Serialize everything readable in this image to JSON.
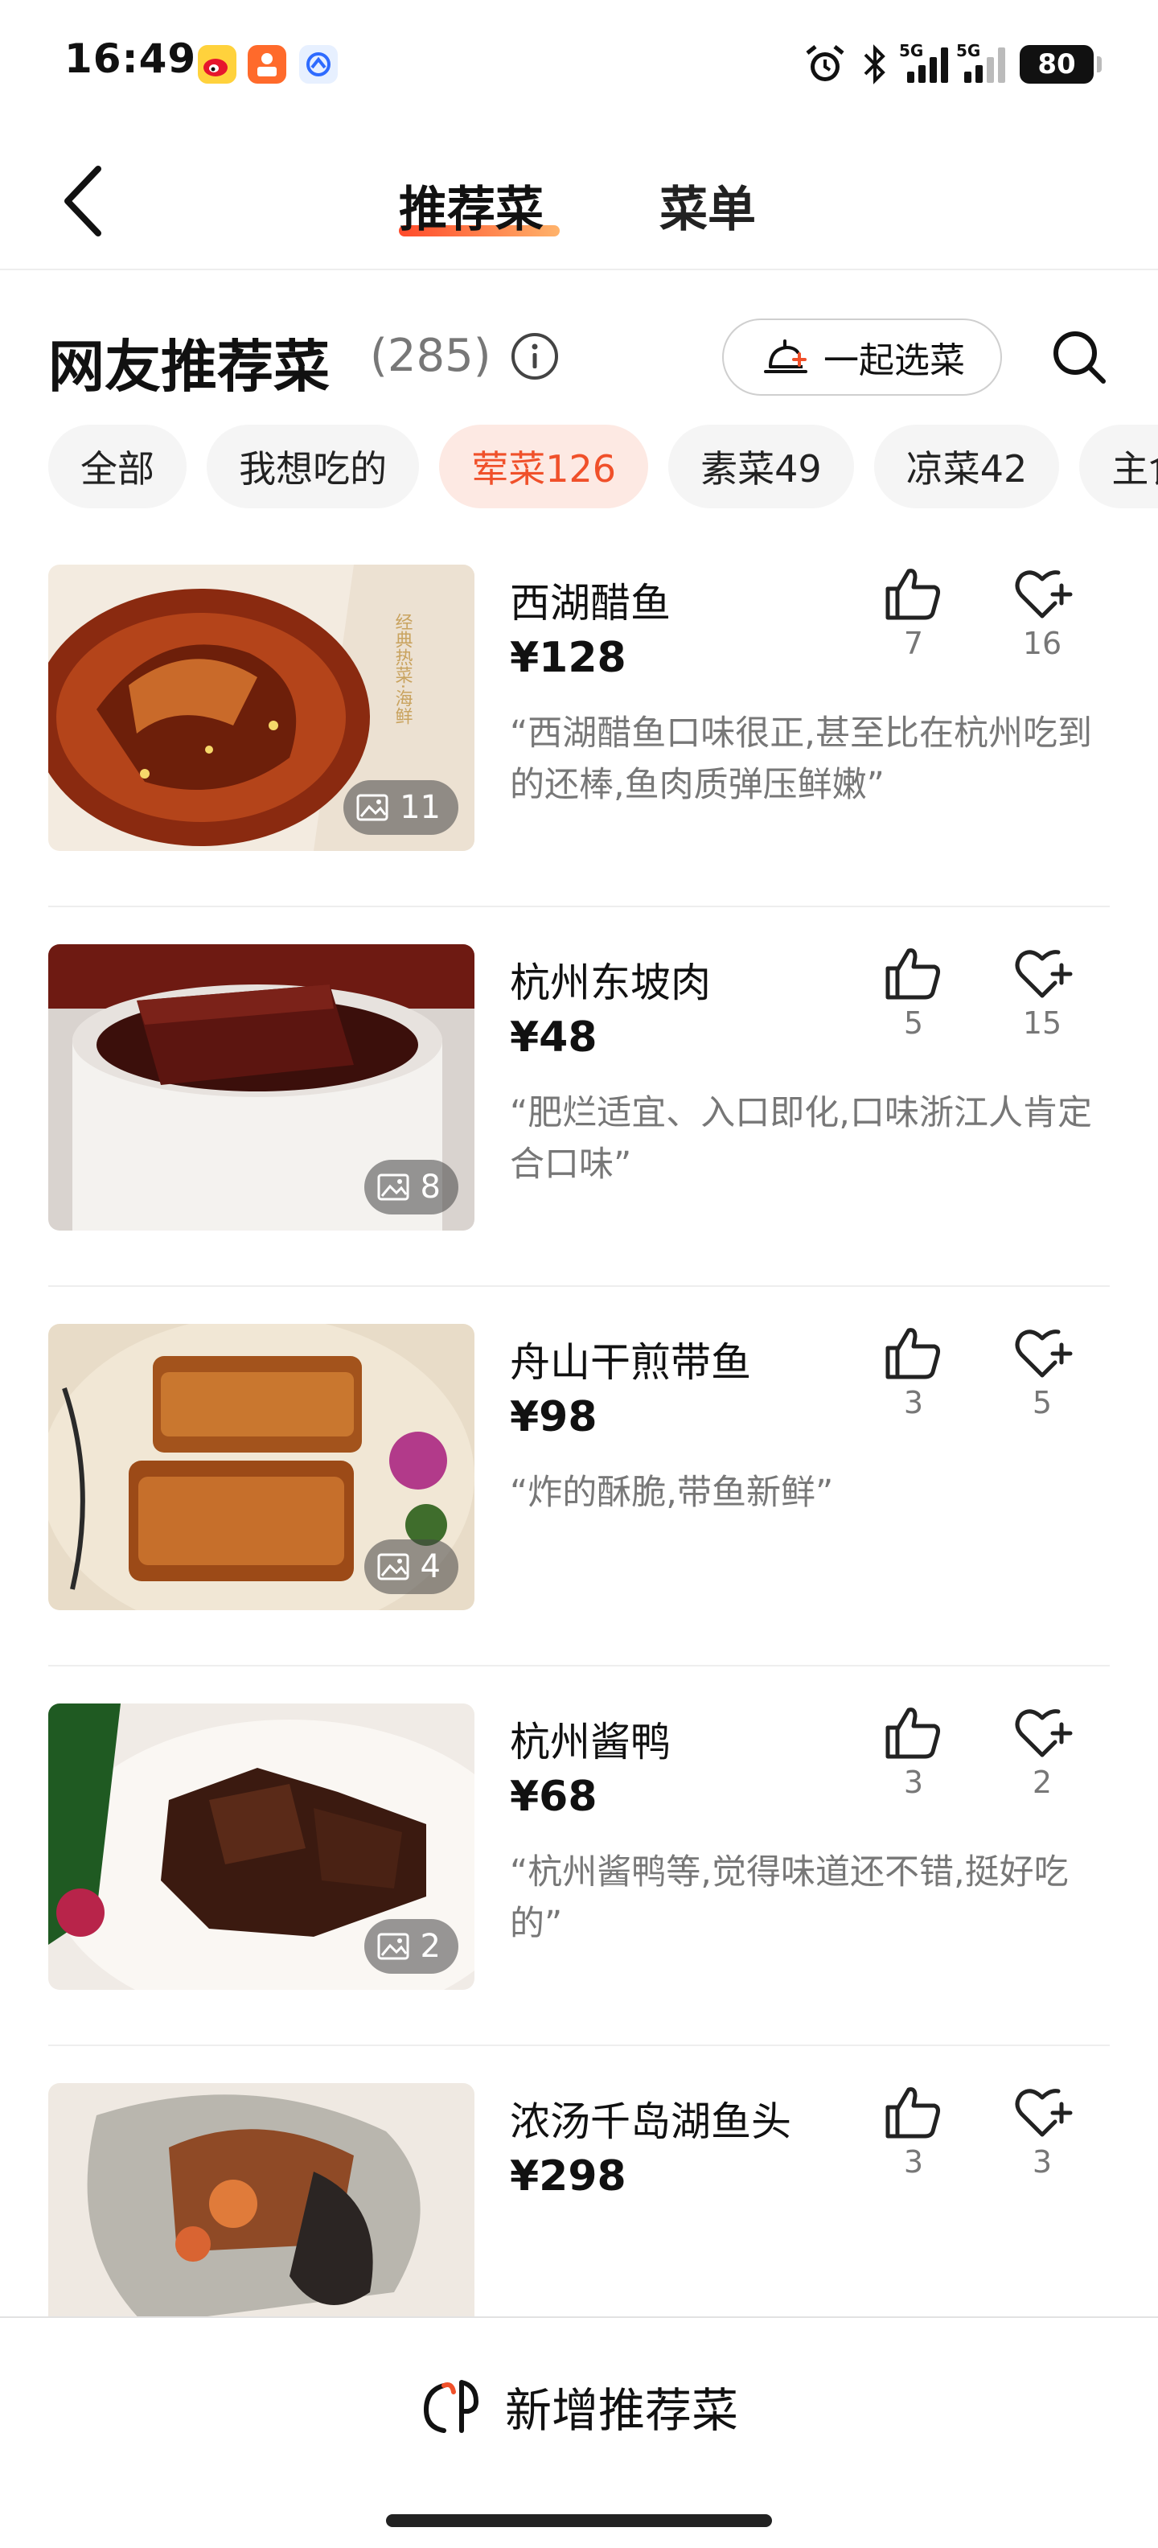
{
  "status_bar": {
    "time": "16:49",
    "network_1": "5G",
    "network_2": "5G",
    "battery": "80",
    "app_icons": [
      "weibo-icon",
      "app-orange-icon",
      "app-blue-icon"
    ],
    "status_icons": [
      "alarm-icon",
      "bluetooth-icon",
      "signal-icon",
      "signal-icon",
      "battery-icon"
    ]
  },
  "nav": {
    "back_icon": "chevron-left-icon",
    "tabs": [
      {
        "label": "推荐菜",
        "active": true
      },
      {
        "label": "菜单",
        "active": false
      }
    ]
  },
  "section": {
    "title": "网友推荐菜",
    "count": "(285)",
    "info_icon": "info-icon",
    "together_button": "一起选菜",
    "together_icon": "dish-cover-icon",
    "search_icon": "search-icon"
  },
  "filters": [
    {
      "label": "全部",
      "active": false
    },
    {
      "label": "我想吃的",
      "active": false
    },
    {
      "label": "荤菜126",
      "active": true
    },
    {
      "label": "素菜49",
      "active": false
    },
    {
      "label": "凉菜42",
      "active": false
    },
    {
      "label": "主食",
      "active": false
    }
  ],
  "dishes": [
    {
      "name": "西湖醋鱼",
      "price": "¥128",
      "quote": "“西湖醋鱼口味很正,甚至比在杭州吃到的还棒,鱼肉质弹压鲜嫩”",
      "photos": "11",
      "likes": "7",
      "favorites": "16"
    },
    {
      "name": "杭州东坡肉",
      "price": "¥48",
      "quote": "“肥烂适宜、入口即化,口味浙江人肯定合口味”",
      "photos": "8",
      "likes": "5",
      "favorites": "15"
    },
    {
      "name": "舟山干煎带鱼",
      "price": "¥98",
      "quote": "“炸的酥脆,带鱼新鲜”",
      "photos": "4",
      "likes": "3",
      "favorites": "5"
    },
    {
      "name": "杭州酱鸭",
      "price": "¥68",
      "quote": "“杭州酱鸭等,觉得味道还不错,挺好吃的”",
      "photos": "2",
      "likes": "3",
      "favorites": "2"
    },
    {
      "name": "浓汤千岛湖鱼头",
      "price": "¥298",
      "quote": "",
      "photos": "",
      "likes": "3",
      "favorites": "3"
    }
  ],
  "image_overlay_text": "经典热菜·海鲜",
  "icons": {
    "like": "thumbs-up-icon",
    "favorite": "heart-plus-icon",
    "photo": "image-icon",
    "add": "chef-icon"
  },
  "bottom": {
    "add_label": "新增推荐菜"
  },
  "colors": {
    "accent": "#f0502a",
    "chip_active_bg": "#fde9e3",
    "chip_bg": "#f5f5f5",
    "muted_text": "#777777"
  }
}
